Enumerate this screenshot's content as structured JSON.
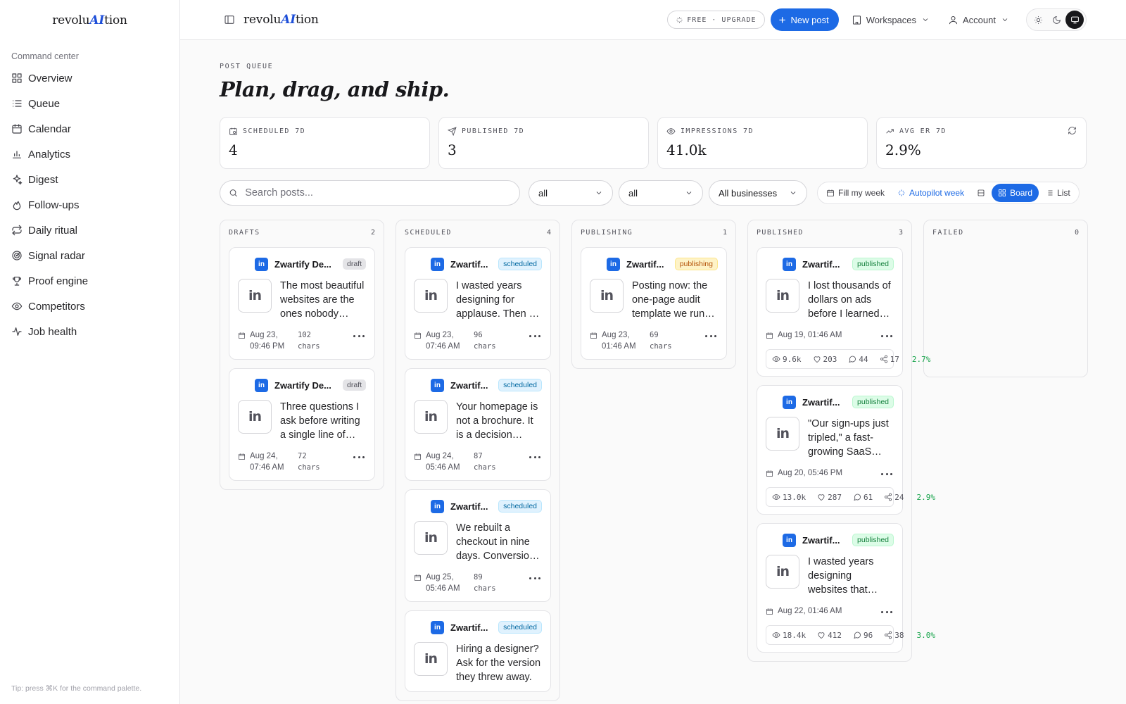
{
  "brand": {
    "prefix": "revolu",
    "ai": "AI",
    "suffix": "tion"
  },
  "sidebar": {
    "section": "Command center",
    "items": [
      {
        "label": "Overview",
        "icon": "grid-icon"
      },
      {
        "label": "Queue",
        "icon": "list-icon"
      },
      {
        "label": "Calendar",
        "icon": "calendar-icon"
      },
      {
        "label": "Analytics",
        "icon": "bar-chart-icon"
      },
      {
        "label": "Digest",
        "icon": "sparkles-icon"
      },
      {
        "label": "Follow-ups",
        "icon": "flame-icon"
      },
      {
        "label": "Daily ritual",
        "icon": "repeat-icon"
      },
      {
        "label": "Signal radar",
        "icon": "radar-icon"
      },
      {
        "label": "Proof engine",
        "icon": "trophy-icon"
      },
      {
        "label": "Competitors",
        "icon": "eye-icon"
      },
      {
        "label": "Job health",
        "icon": "activity-icon"
      }
    ],
    "tip": "Tip: press ⌘K for the command palette."
  },
  "topbar": {
    "plan": "FREE · UPGRADE",
    "new_post": "New post",
    "workspaces": "Workspaces",
    "account": "Account"
  },
  "page": {
    "eyebrow": "POST QUEUE",
    "title": "Plan, drag, and ship."
  },
  "stats": [
    {
      "label": "SCHEDULED 7D",
      "value": "4",
      "icon": "calendar-clock-icon"
    },
    {
      "label": "PUBLISHED 7D",
      "value": "3",
      "icon": "send-icon"
    },
    {
      "label": "IMPRESSIONS 7D",
      "value": "41.0k",
      "icon": "eye-icon"
    },
    {
      "label": "AVG ER 7D",
      "value": "2.9%",
      "icon": "trending-up-icon"
    }
  ],
  "filters": {
    "search_placeholder": "Search posts...",
    "status": "all",
    "platform": "all",
    "business": "All businesses",
    "fill_week": "Fill my week",
    "autopilot": "Autopilot week",
    "board": "Board",
    "list": "List"
  },
  "columns": [
    {
      "title": "DRAFTS",
      "count": "2",
      "cards": [
        {
          "business": "Zwartify De...",
          "status": "draft",
          "excerpt": "The most beautiful websites are the ones nobody notices.",
          "date": "Aug 23, 09:46 PM",
          "chars": "102 chars"
        },
        {
          "business": "Zwartify De...",
          "status": "draft",
          "excerpt": "Three questions I ask before writing a single line of code.",
          "date": "Aug 24, 07:46 AM",
          "chars": "72 chars"
        }
      ]
    },
    {
      "title": "SCHEDULED",
      "count": "4",
      "cards": [
        {
          "business": "Zwartif...",
          "status": "scheduled",
          "excerpt": "I wasted years designing for applause. Then I learned better.",
          "date": "Aug 23, 07:46 AM",
          "chars": "96 chars"
        },
        {
          "business": "Zwartif...",
          "status": "scheduled",
          "excerpt": "Your homepage is not a brochure. It is a decision engine.",
          "date": "Aug 24, 05:46 AM",
          "chars": "87 chars"
        },
        {
          "business": "Zwartif...",
          "status": "scheduled",
          "excerpt": "We rebuilt a checkout in nine days. Conversions doubled.",
          "date": "Aug 25, 05:46 AM",
          "chars": "89 chars"
        },
        {
          "business": "Zwartif...",
          "status": "scheduled",
          "excerpt": "Hiring a designer? Ask for the version they threw away.",
          "date": "",
          "chars": ""
        }
      ]
    },
    {
      "title": "PUBLISHING",
      "count": "1",
      "cards": [
        {
          "business": "Zwartif...",
          "status": "publishing",
          "excerpt": "Posting now: the one-page audit template we run on every site.",
          "date": "Aug 23, 01:46 AM",
          "chars": "69 chars"
        }
      ]
    },
    {
      "title": "PUBLISHED",
      "count": "3",
      "cards": [
        {
          "business": "Zwartif...",
          "status": "published",
          "excerpt": "I lost thousands of dollars on ads before I learned this.",
          "date": "Aug 19, 01:46 AM",
          "chars": "",
          "metrics": {
            "views": "9.6k",
            "likes": "203",
            "comments": "44",
            "shares": "17",
            "er": "2.7%"
          }
        },
        {
          "business": "Zwartif...",
          "status": "published",
          "excerpt": "\"Our sign-ups just tripled,\" a fast-growing SaaS founder told me.",
          "date": "Aug 20, 05:46 PM",
          "chars": "",
          "metrics": {
            "views": "13.0k",
            "likes": "287",
            "comments": "61",
            "shares": "24",
            "er": "2.9%"
          }
        },
        {
          "business": "Zwartif...",
          "status": "published",
          "excerpt": "I wasted years designing websites that nobody used.",
          "date": "Aug 22, 01:46 AM",
          "chars": "",
          "metrics": {
            "views": "18.4k",
            "likes": "412",
            "comments": "96",
            "shares": "38",
            "er": "3.0%"
          }
        }
      ]
    },
    {
      "title": "FAILED",
      "count": "0",
      "cards": []
    }
  ],
  "colors": {
    "accent": "#1d6ae5",
    "success": "#16a34a",
    "warning": "#b45309",
    "info": "#0369a1"
  }
}
